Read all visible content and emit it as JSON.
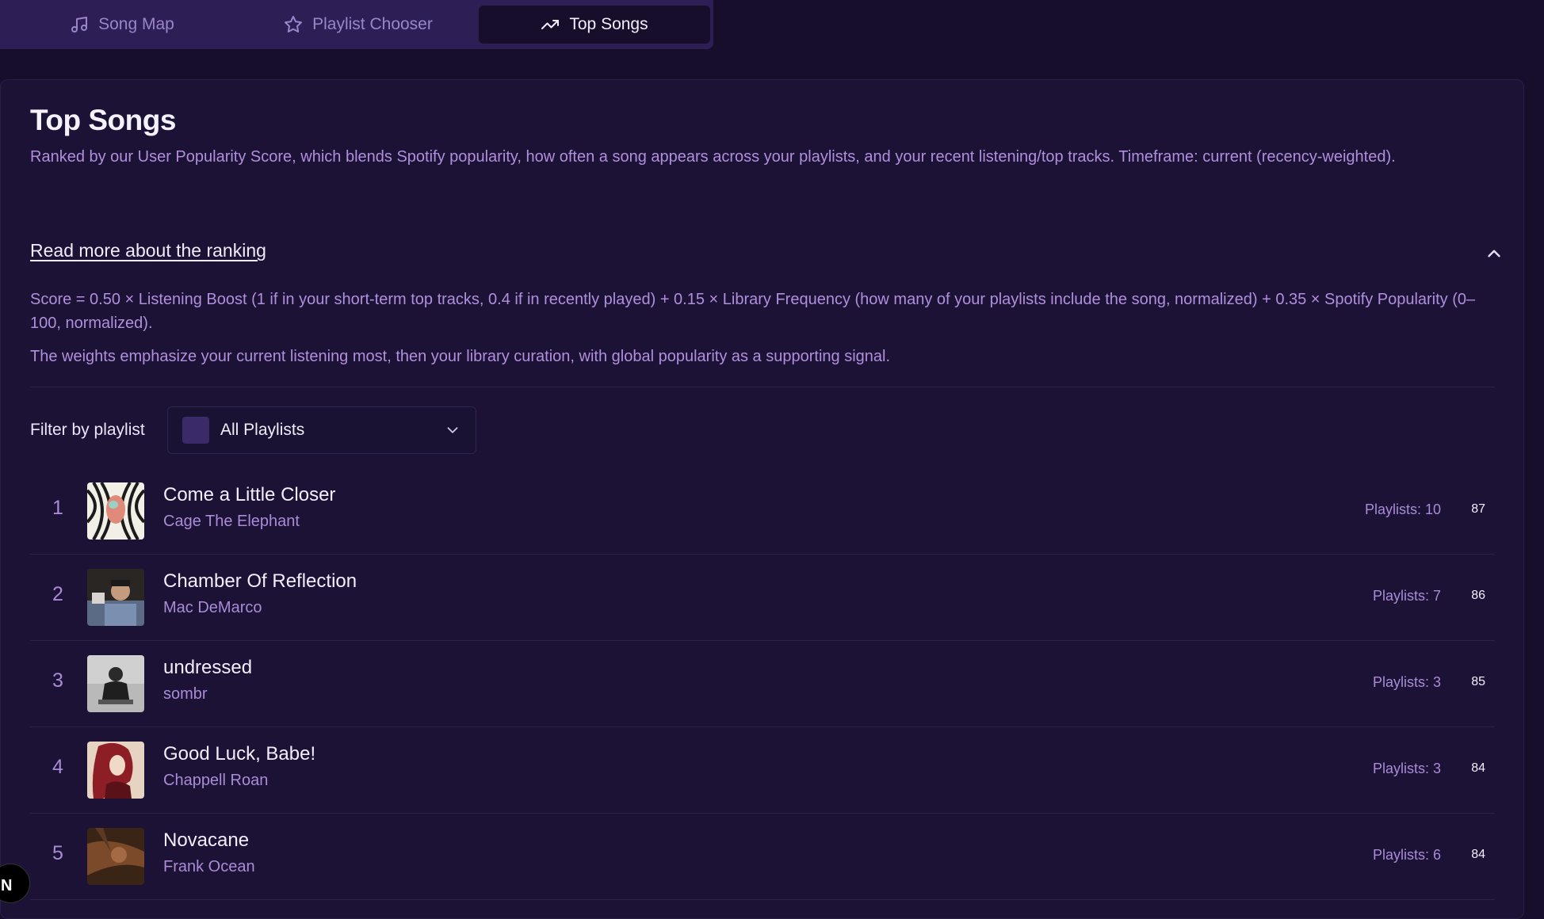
{
  "tabs": [
    {
      "label": "Song Map",
      "icon": "music-note-icon",
      "active": false
    },
    {
      "label": "Playlist Chooser",
      "icon": "star-icon",
      "active": false
    },
    {
      "label": "Top Songs",
      "icon": "trending-up-icon",
      "active": true
    }
  ],
  "page": {
    "title": "Top Songs",
    "description": "Ranked by our User Popularity Score, which blends Spotify popularity, how often a song appears across your playlists, and your recent listening/top tracks. Timeframe: current (recency-weighted).",
    "read_more": "Read more about the ranking",
    "formula": "Score = 0.50 × Listening Boost (1 if in your short-term top tracks, 0.4 if in recently played) + 0.15 × Library Frequency (how many of your playlists include the song, normalized) + 0.35 × Spotify Popularity (0–100, normalized).",
    "weights_note": "The weights emphasize your current listening most, then your library curation, with global popularity as a supporting signal."
  },
  "filter": {
    "label": "Filter by playlist",
    "selected": "All Playlists"
  },
  "songs": [
    {
      "rank": "1",
      "title": "Come a Little Closer",
      "artist": "Cage The Elephant",
      "playlists": "Playlists: 10",
      "score": "87"
    },
    {
      "rank": "2",
      "title": "Chamber Of Reflection",
      "artist": "Mac DeMarco",
      "playlists": "Playlists: 7",
      "score": "86"
    },
    {
      "rank": "3",
      "title": "undressed",
      "artist": "sombr",
      "playlists": "Playlists: 3",
      "score": "85"
    },
    {
      "rank": "4",
      "title": "Good Luck, Babe!",
      "artist": "Chappell Roan",
      "playlists": "Playlists: 3",
      "score": "84"
    },
    {
      "rank": "5",
      "title": "Novacane",
      "artist": "Frank Ocean",
      "playlists": "Playlists: 6",
      "score": "84"
    }
  ],
  "corner_badge": "N"
}
